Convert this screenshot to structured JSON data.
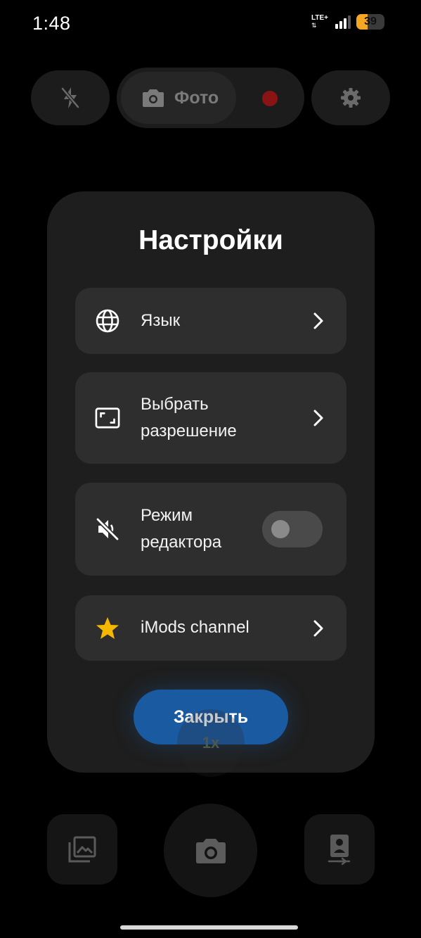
{
  "status_bar": {
    "time": "1:48",
    "network": "LTE+",
    "network_arrows": "⇅",
    "battery_percent": "39",
    "signal_bars": 3
  },
  "top_controls": {
    "flash_icon": "flash-off-icon",
    "mode_label": "Фото",
    "mode_icon": "camera-icon",
    "record_color": "#8a1414",
    "settings_icon": "gear-icon"
  },
  "settings_modal": {
    "title": "Настройки",
    "items": [
      {
        "label": "Язык",
        "icon": "globe-icon",
        "control": "chevron"
      },
      {
        "label_line1": "Выбрать",
        "label_line2": "разрешение",
        "icon": "resolution-frame-icon",
        "control": "chevron"
      },
      {
        "label_line1": "Режим",
        "label_line2": "редактора",
        "icon": "mute-icon",
        "control": "toggle",
        "toggle_on": false
      },
      {
        "label": "iMods channel",
        "icon": "star-icon",
        "control": "chevron"
      }
    ],
    "close_label": "Закрыть",
    "accent_color": "#1a5aa0",
    "star_color": "#f5b800"
  },
  "zoom": {
    "label": "1x"
  },
  "bottom_controls": {
    "gallery_icon": "gallery-icon",
    "shutter_icon": "camera-icon",
    "switch_icon": "switch-camera-icon"
  }
}
